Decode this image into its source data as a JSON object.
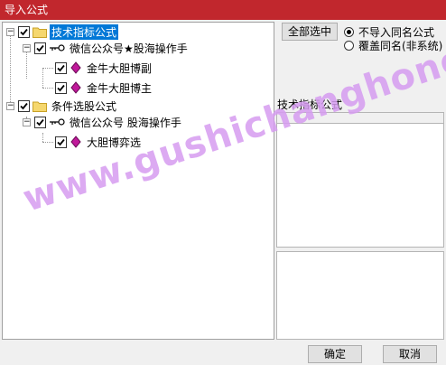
{
  "window": {
    "title": "导入公式"
  },
  "tree": {
    "groups": [
      {
        "label": "技术指标公式",
        "checked": true,
        "selected": true,
        "children": [
          {
            "label": "微信公众号★股海操作手",
            "checked": true,
            "children": [
              {
                "label": "金牛大胆博副",
                "checked": true
              },
              {
                "label": "金牛大胆博主",
                "checked": true
              }
            ]
          }
        ]
      },
      {
        "label": "条件选股公式",
        "checked": true,
        "selected": false,
        "children": [
          {
            "label": "微信公众号 股海操作手",
            "checked": true,
            "children": [
              {
                "label": "大胆博弈选",
                "checked": true
              }
            ]
          }
        ]
      }
    ]
  },
  "options": {
    "select_all_label": "全部选中",
    "radio_no_import": "不导入同名公式",
    "radio_overwrite": "覆盖同名(非系统)",
    "selected_radio": "no_import"
  },
  "detail": {
    "category_label": "技术指标公式"
  },
  "footer": {
    "ok_label": "确定",
    "cancel_label": "取消"
  },
  "watermark": {
    "text": "www.gushichanghong.com"
  },
  "colors": {
    "titlebar": "#c1272d",
    "selection": "#0078d7",
    "watermark": "#d69cf0",
    "gem": "#c0199a",
    "folder": "#f5d76e"
  }
}
